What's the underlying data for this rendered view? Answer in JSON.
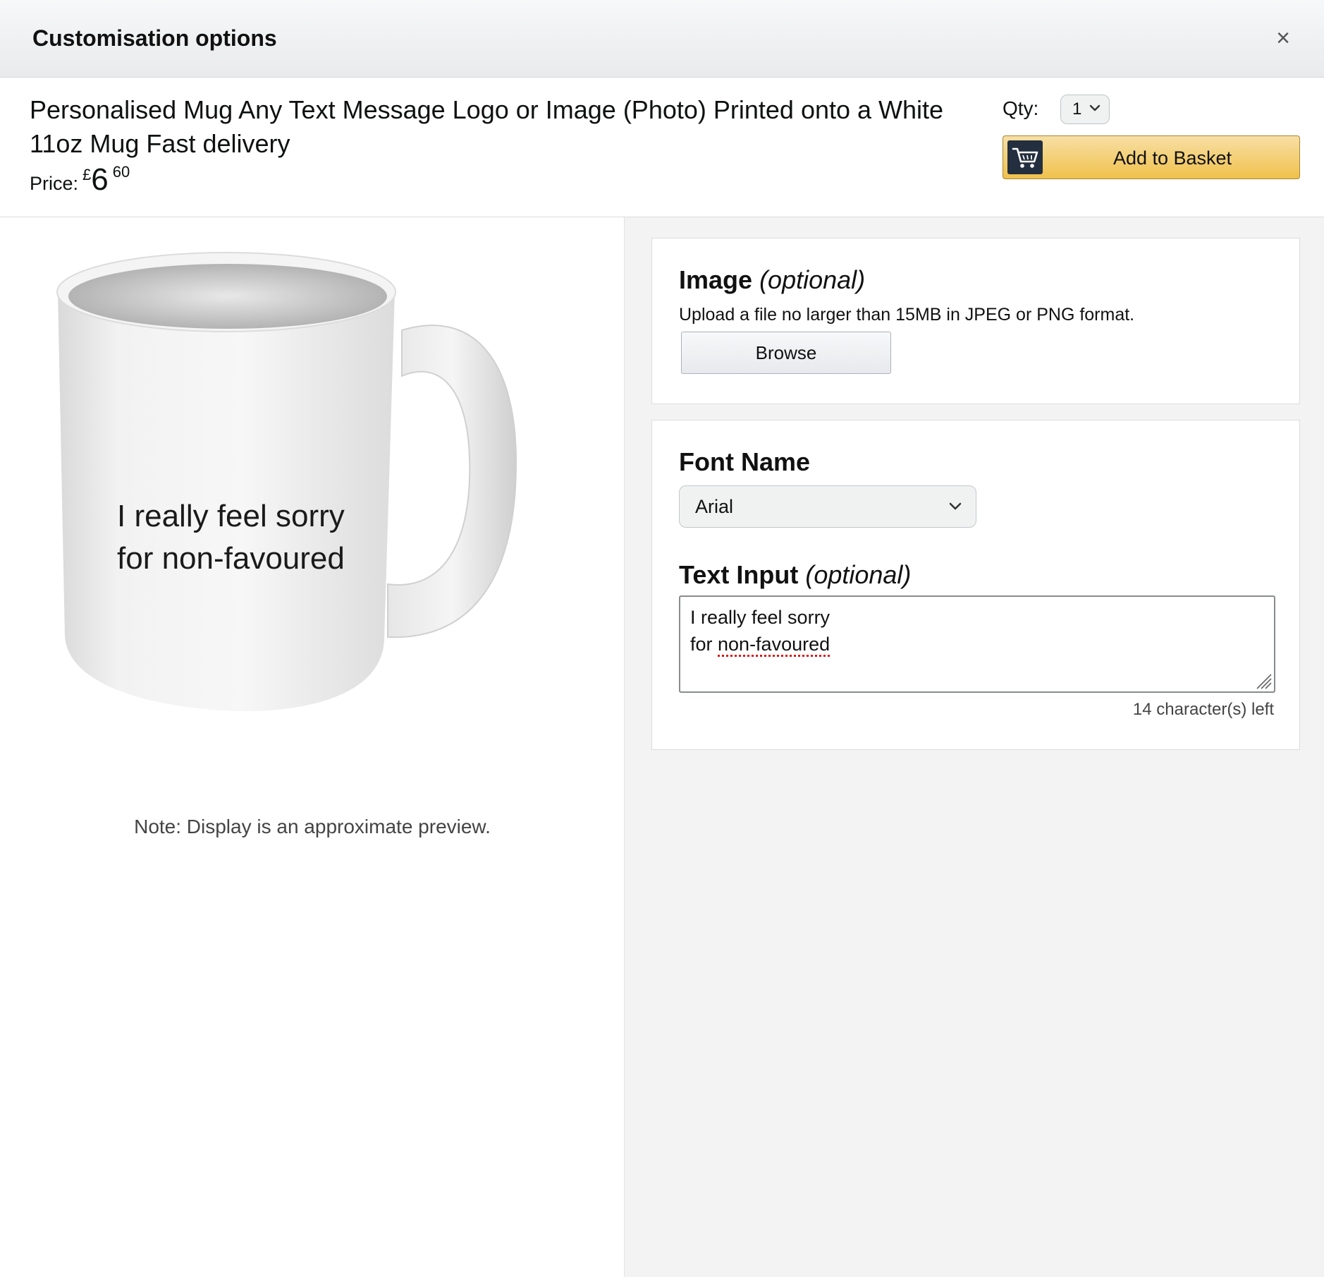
{
  "header": {
    "title": "Customisation options",
    "close_symbol": "×"
  },
  "product": {
    "title": "Personalised Mug Any Text Message Logo or Image (Photo) Printed onto a White 11oz Mug Fast delivery",
    "price_label": "Price:",
    "currency": "£",
    "price_whole": "6",
    "price_fraction": "60"
  },
  "purchase": {
    "qty_label": "Qty:",
    "qty_value": "1",
    "add_to_basket_label": "Add to Basket",
    "button_color": "#f0c14b"
  },
  "preview": {
    "mug_text": "I really feel sorry\nfor non-favoured",
    "note": "Note: Display is an approximate preview."
  },
  "image_option": {
    "title": "Image",
    "optional_label": "(optional)",
    "hint": "Upload a file no larger than 15MB in JPEG or PNG format.",
    "browse_label": "Browse"
  },
  "font_option": {
    "title": "Font Name",
    "selected": "Arial"
  },
  "text_option": {
    "title": "Text Input",
    "optional_label": "(optional)",
    "line1": "I really feel sorry",
    "line2_prefix": "for ",
    "line2_flagged": "non-favoured",
    "chars_left": "14 character(s) left"
  },
  "icons": [
    "close-icon",
    "chevron-down-icon",
    "cart-icon",
    "resize-grip-icon"
  ]
}
